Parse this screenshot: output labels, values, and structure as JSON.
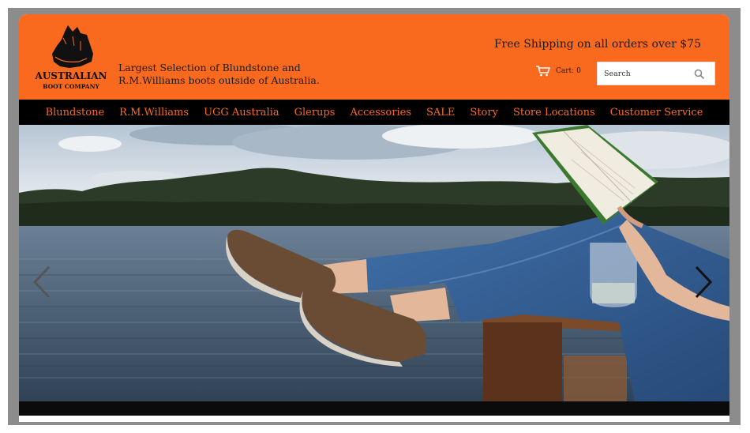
{
  "brand": {
    "logo_text_line1": "AUSTRALIAN",
    "logo_text_line2": "BOOT COMPANY",
    "tagline_line1": "Largest Selection of Blundstone and",
    "tagline_line2": "R.M.Williams boots outside of Australia."
  },
  "header": {
    "shipping": "Free Shipping on all orders over $75",
    "cart_label": "Cart: 0",
    "search_placeholder": "Search"
  },
  "nav": {
    "items": [
      {
        "label": "Blundstone"
      },
      {
        "label": "R.M.Williams"
      },
      {
        "label": "UGG Australia"
      },
      {
        "label": "Glerups"
      },
      {
        "label": "Accessories"
      },
      {
        "label": "SALE"
      },
      {
        "label": "Story"
      },
      {
        "label": "Store Locations"
      },
      {
        "label": "Customer Service"
      }
    ]
  },
  "hero": {
    "prev_icon": "chevron-left-icon",
    "next_icon": "chevron-right-icon"
  },
  "colors": {
    "brand_orange": "#fa6a1e",
    "nav_background": "#000000",
    "nav_text": "#fa6a1e"
  }
}
